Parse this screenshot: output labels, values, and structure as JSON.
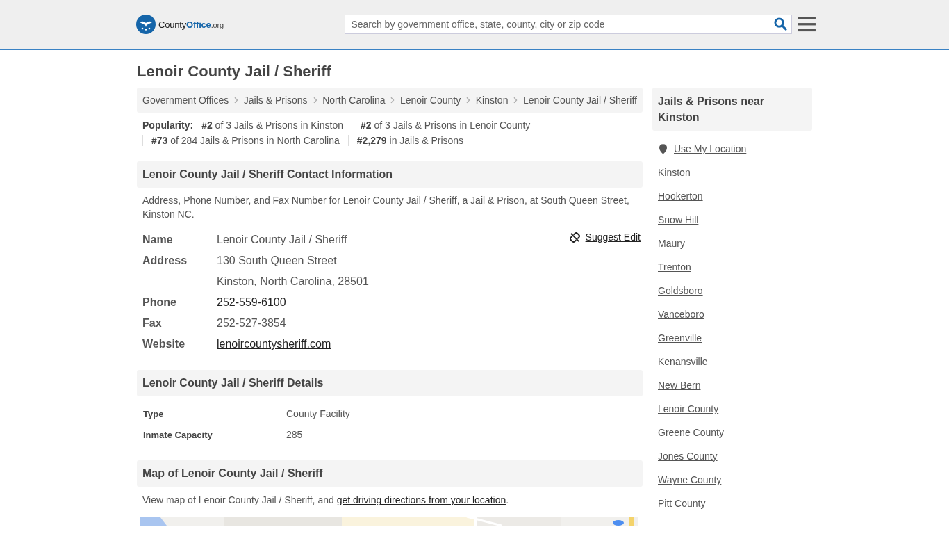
{
  "header": {
    "logo": {
      "parts": [
        "County",
        "Office",
        ".org"
      ]
    },
    "search": {
      "placeholder": "Search by government office, state, county, city or zip code"
    }
  },
  "title": "Lenoir County Jail / Sheriff",
  "breadcrumbs": [
    "Government Offices",
    "Jails & Prisons",
    "North Carolina",
    "Lenoir County",
    "Kinston",
    "Lenoir County Jail / Sheriff"
  ],
  "popularity": {
    "label": "Popularity:",
    "items": [
      "**#2** of 3 Jails & Prisons in Kinston",
      "**#2** of 3 Jails & Prisons in Lenoir County",
      "**#73** of 284 Jails & Prisons in North Carolina",
      "**#2,279** in Jails & Prisons"
    ]
  },
  "contact": {
    "heading": "Lenoir County Jail / Sheriff Contact Information",
    "description": "Address, Phone Number, and Fax Number for Lenoir County Jail / Sheriff, a Jail & Prison, at South Queen Street, Kinston NC.",
    "suggest_edit": "Suggest Edit",
    "rows": [
      {
        "label": "Name",
        "value": "Lenoir County Jail / Sheriff",
        "kind": "text"
      },
      {
        "label": "Address",
        "value": "130 South Queen Street",
        "kind": "text"
      },
      {
        "label": "",
        "value": "Kinston, North Carolina, 28501",
        "kind": "text"
      },
      {
        "label": "Phone",
        "value": "252-559-6100",
        "kind": "link"
      },
      {
        "label": "Fax",
        "value": "252-527-3854",
        "kind": "text"
      },
      {
        "label": "Website",
        "value": "lenoircountysheriff.com",
        "kind": "link"
      }
    ]
  },
  "details": {
    "heading": "Lenoir County Jail / Sheriff Details",
    "rows": [
      {
        "label": "Type",
        "value": "County Facility"
      },
      {
        "label": "Inmate Capacity",
        "value": "285"
      }
    ]
  },
  "map": {
    "heading": "Map of Lenoir County Jail / Sheriff",
    "text": "View map of Lenoir County Jail / Sheriff, and ",
    "link": "get driving directions from your location",
    "end": ".",
    "kind": "picture"
  },
  "sidebar": {
    "heading": "Jails & Prisons near Kinston",
    "use_location": "Use My Location",
    "links": [
      "Kinston",
      "Hookerton",
      "Snow Hill",
      "Maury",
      "Trenton",
      "Goldsboro",
      "Vanceboro",
      "Greenville",
      "Kenansville",
      "New Bern",
      "Lenoir County",
      "Greene County",
      "Jones County",
      "Wayne County",
      "Pitt County"
    ]
  }
}
